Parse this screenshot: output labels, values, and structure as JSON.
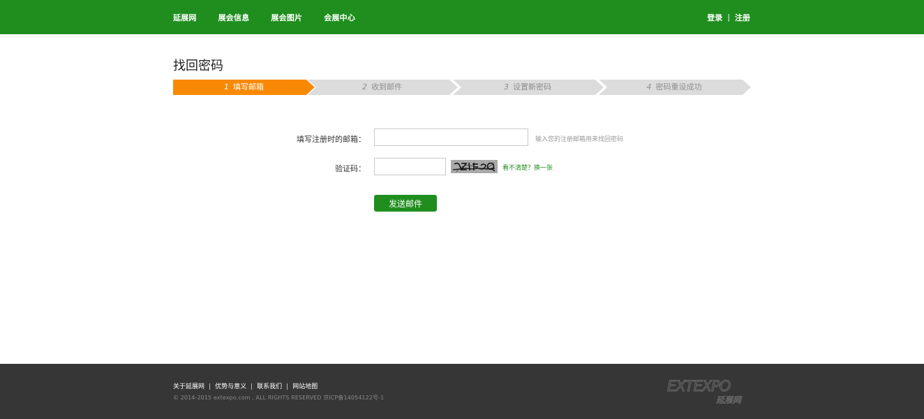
{
  "header": {
    "nav": [
      "延展网",
      "展会信息",
      "展会图片",
      "会展中心"
    ],
    "login": "登录",
    "separator": "|",
    "register": "注册"
  },
  "page": {
    "title": "找回密码"
  },
  "steps": [
    {
      "num": "1",
      "label": "填写邮箱",
      "active": true
    },
    {
      "num": "2",
      "label": "收到邮件",
      "active": false
    },
    {
      "num": "3",
      "label": "设置新密码",
      "active": false
    },
    {
      "num": "4",
      "label": "密码重设成功",
      "active": false
    }
  ],
  "form": {
    "email_label": "填写注册时的邮箱：",
    "email_value": "",
    "email_hint": "输入您的注册邮箱用来找回密码",
    "captcha_label": "验证码：",
    "captcha_value": "",
    "captcha_text": "BZLFQ",
    "refresh_link": "看不清楚？换一张",
    "submit_label": "发送邮件"
  },
  "footer": {
    "links": [
      "关于延展网",
      "优势与意义",
      "联系我们",
      "网站地图"
    ],
    "separator": "|",
    "copyright": "© 2014-2015 extexpo.com , ALL RIGHTS RESERVED  京ICP备14054122号-1",
    "logo_text": "EXTEXPO",
    "logo_subtext": "延展网"
  },
  "colors": {
    "brand_green": "#1f8e1e",
    "step_active": "#f98905",
    "step_inactive": "#dcdcdc",
    "footer_bg": "#363636"
  }
}
